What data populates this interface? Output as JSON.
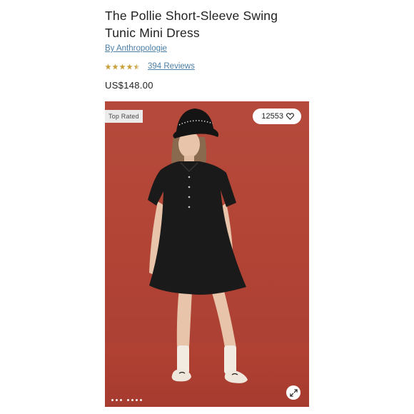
{
  "product": {
    "title_line1": "The Pollie Short-Sleeve Swing",
    "title_line2": "Tunic Mini Dress",
    "brand": "By Anthropologie",
    "rating": 4.5,
    "reviews_label": "394 Reviews",
    "price": "US$148.00"
  },
  "gallery": {
    "badge": "Top Rated",
    "likes": "12553",
    "image_count": 7,
    "current_image": 1,
    "image_description": "Model wearing black short-sleeve swing tunic mini dress and black bucket hat against a red backdrop"
  },
  "colors": {
    "link": "#4d7fa6",
    "star": "#c9a13b",
    "backdrop": "#b34536",
    "dress": "#1a1a1a"
  },
  "icons": {
    "star": "star-icon",
    "heart": "heart-outline-icon",
    "expand": "expand-arrows-icon"
  }
}
